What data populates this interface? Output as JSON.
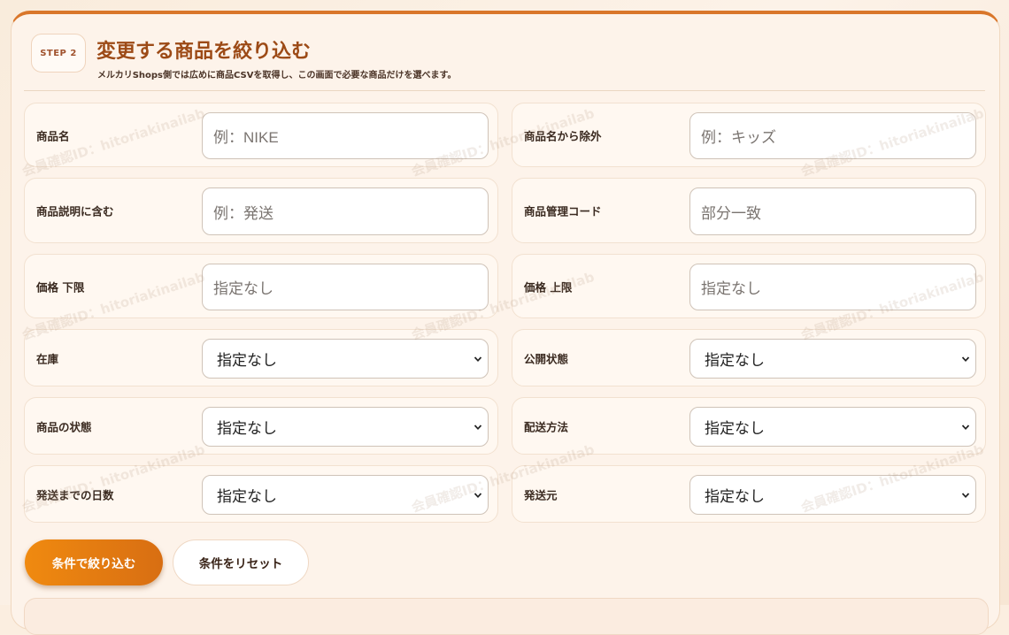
{
  "step": {
    "label": "STEP 2"
  },
  "header": {
    "title": "変更する商品を絞り込む",
    "subtitle": "メルカリShops側では広めに商品CSVを取得し、この画面で必要な商品だけを選べます。"
  },
  "watermark": "会員確認ID：hitoriakinailab",
  "filters": {
    "product_name": {
      "label": "商品名",
      "placeholder": "例：NIKE"
    },
    "exclude_name": {
      "label": "商品名から除外",
      "placeholder": "例：キッズ"
    },
    "description": {
      "label": "商品説明に含む",
      "placeholder": "例：発送"
    },
    "sku": {
      "label": "商品管理コード",
      "placeholder": "部分一致"
    },
    "price_min": {
      "label": "価格 下限",
      "placeholder": "指定なし"
    },
    "price_max": {
      "label": "価格 上限",
      "placeholder": "指定なし"
    },
    "stock": {
      "label": "在庫",
      "value": "指定なし"
    },
    "visibility": {
      "label": "公開状態",
      "value": "指定なし"
    },
    "condition": {
      "label": "商品の状態",
      "value": "指定なし"
    },
    "shipping_method": {
      "label": "配送方法",
      "value": "指定なし"
    },
    "days_to_ship": {
      "label": "発送までの日数",
      "value": "指定なし"
    },
    "ship_from": {
      "label": "発送元",
      "value": "指定なし"
    }
  },
  "actions": {
    "apply": "条件で絞り込む",
    "reset": "条件をリセット"
  },
  "colors": {
    "accent": "#d9762a",
    "title": "#9c4a16",
    "primary_button": "#f08a10"
  }
}
